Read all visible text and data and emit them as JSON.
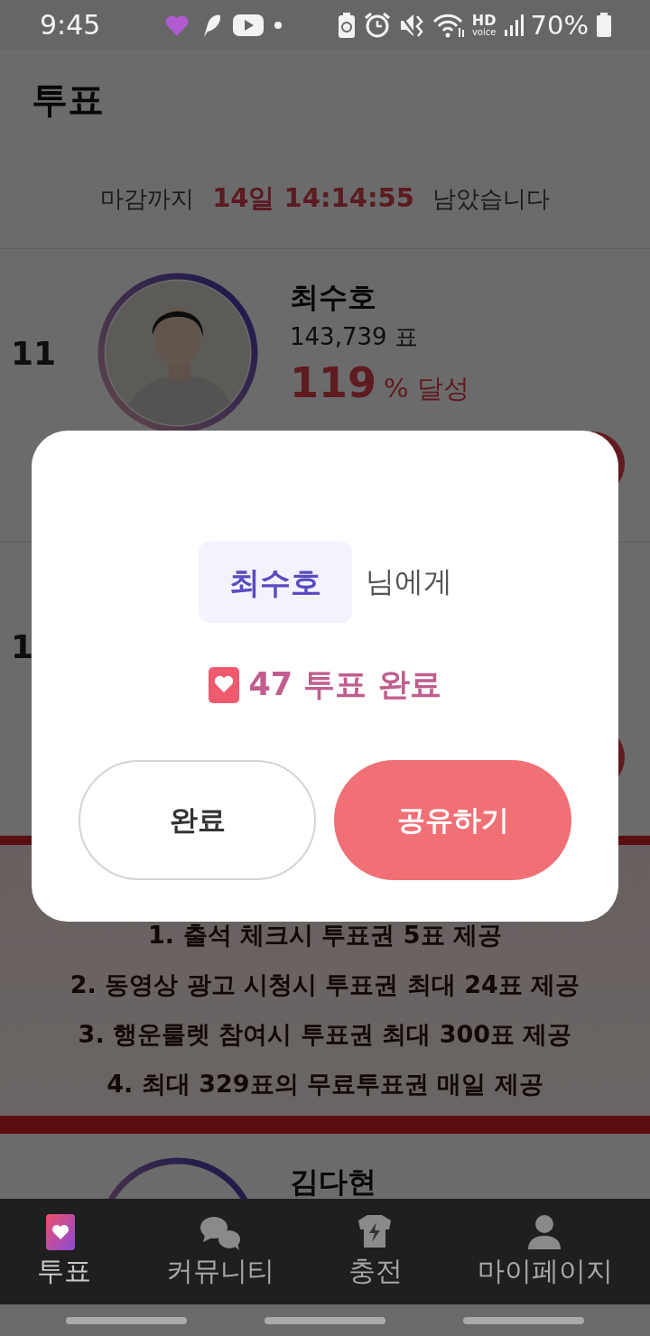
{
  "status_bar": {
    "time": "9:45",
    "network_label": "HD",
    "network_sublabel": "voice",
    "battery": "70%"
  },
  "header": {
    "title": "투표"
  },
  "countdown": {
    "prefix": "마감까지",
    "remaining": "14일 14:14:55",
    "suffix": "남았습니다"
  },
  "candidates": [
    {
      "rank": "11",
      "kind": "full",
      "name": "최수호",
      "votes": "143,739 표",
      "percent": "119",
      "percent_unit": "% 달성"
    },
    {
      "rank": "1",
      "kind": "covered"
    },
    {
      "kind": "name_only",
      "name": "김다현"
    }
  ],
  "banner": {
    "lines": [
      "1. 출석 체크시 투표권 5표 제공",
      "2. 동영상 광고 시청시 투표권 최대 24표 제공",
      "3. 행운룰렛 참여시 투표권 최대 300표 제공",
      "4. 최대 329표의 무료투표권 매일 제공"
    ]
  },
  "bottom_nav": [
    {
      "label": "투표",
      "selected": true
    },
    {
      "label": "커뮤니티",
      "selected": false
    },
    {
      "label": "충전",
      "selected": false
    },
    {
      "label": "마이페이지",
      "selected": false
    }
  ],
  "modal": {
    "recipient": "최수호",
    "recipient_suffix": "님에게",
    "result": "47 투표 완료",
    "buttons": [
      {
        "label": "완료",
        "kind": "outline"
      },
      {
        "label": "공유하기",
        "kind": "primary"
      }
    ]
  }
}
